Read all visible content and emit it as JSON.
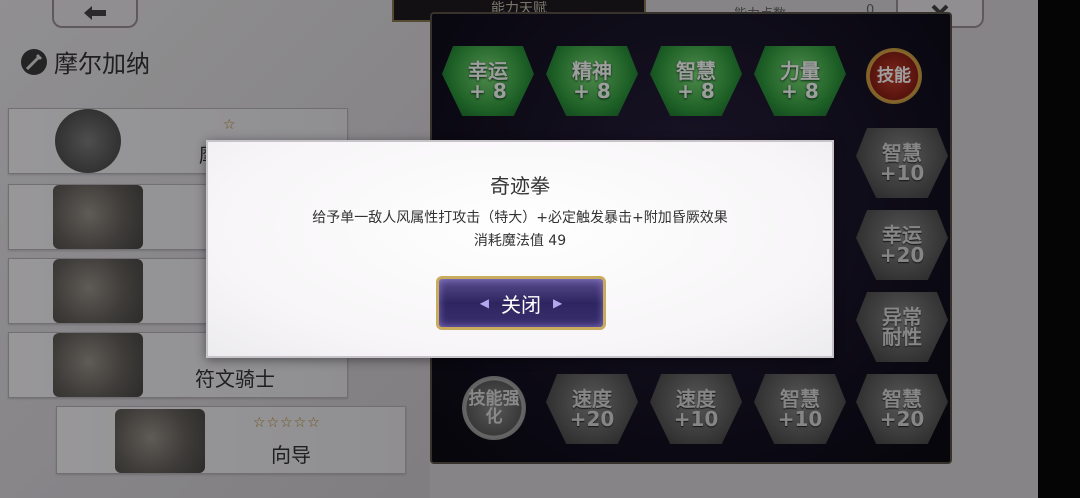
{
  "header": {
    "back_icon": "arrow-left-icon",
    "title": "能力天赋",
    "points_label": "能力点数",
    "points_value": "0",
    "close_icon": "x-icon"
  },
  "character": {
    "name": "摩尔加纳"
  },
  "list": [
    {
      "name": "摩",
      "stars": "☆"
    },
    {
      "name": "",
      "stars": ""
    },
    {
      "name": "",
      "stars": ""
    },
    {
      "name": "符文骑士",
      "stars": ""
    },
    {
      "name": "向导",
      "stars": "☆☆☆☆☆"
    }
  ],
  "board": {
    "row1": [
      {
        "name": "幸运",
        "bonus": "+ 8"
      },
      {
        "name": "精神",
        "bonus": "+ 8"
      },
      {
        "name": "智慧",
        "bonus": "+ 8"
      },
      {
        "name": "力量",
        "bonus": "+ 8"
      }
    ],
    "skill_medal": "技能",
    "right_col": [
      {
        "name": "智慧",
        "bonus": "+10"
      },
      {
        "name": "幸运",
        "bonus": "+20"
      },
      {
        "name": "异常",
        "bonus": "耐性"
      }
    ],
    "bottom_medal": "技能强化",
    "bottom_row": [
      {
        "name": "速度",
        "bonus": "+20"
      },
      {
        "name": "速度",
        "bonus": "+10"
      },
      {
        "name": "智慧",
        "bonus": "+10"
      },
      {
        "name": "智慧",
        "bonus": "+20"
      }
    ]
  },
  "dialog": {
    "title": "奇迹拳",
    "description": "给予单一敌人风属性打攻击（特大）+必定触发暴击+附加昏厥效果",
    "cost": "消耗魔法值 49",
    "close_label": "关闭"
  },
  "colors": {
    "green_node": "#2f9a3d",
    "dialog_button": "#2e2560",
    "gold_border": "#c9ab5e"
  }
}
